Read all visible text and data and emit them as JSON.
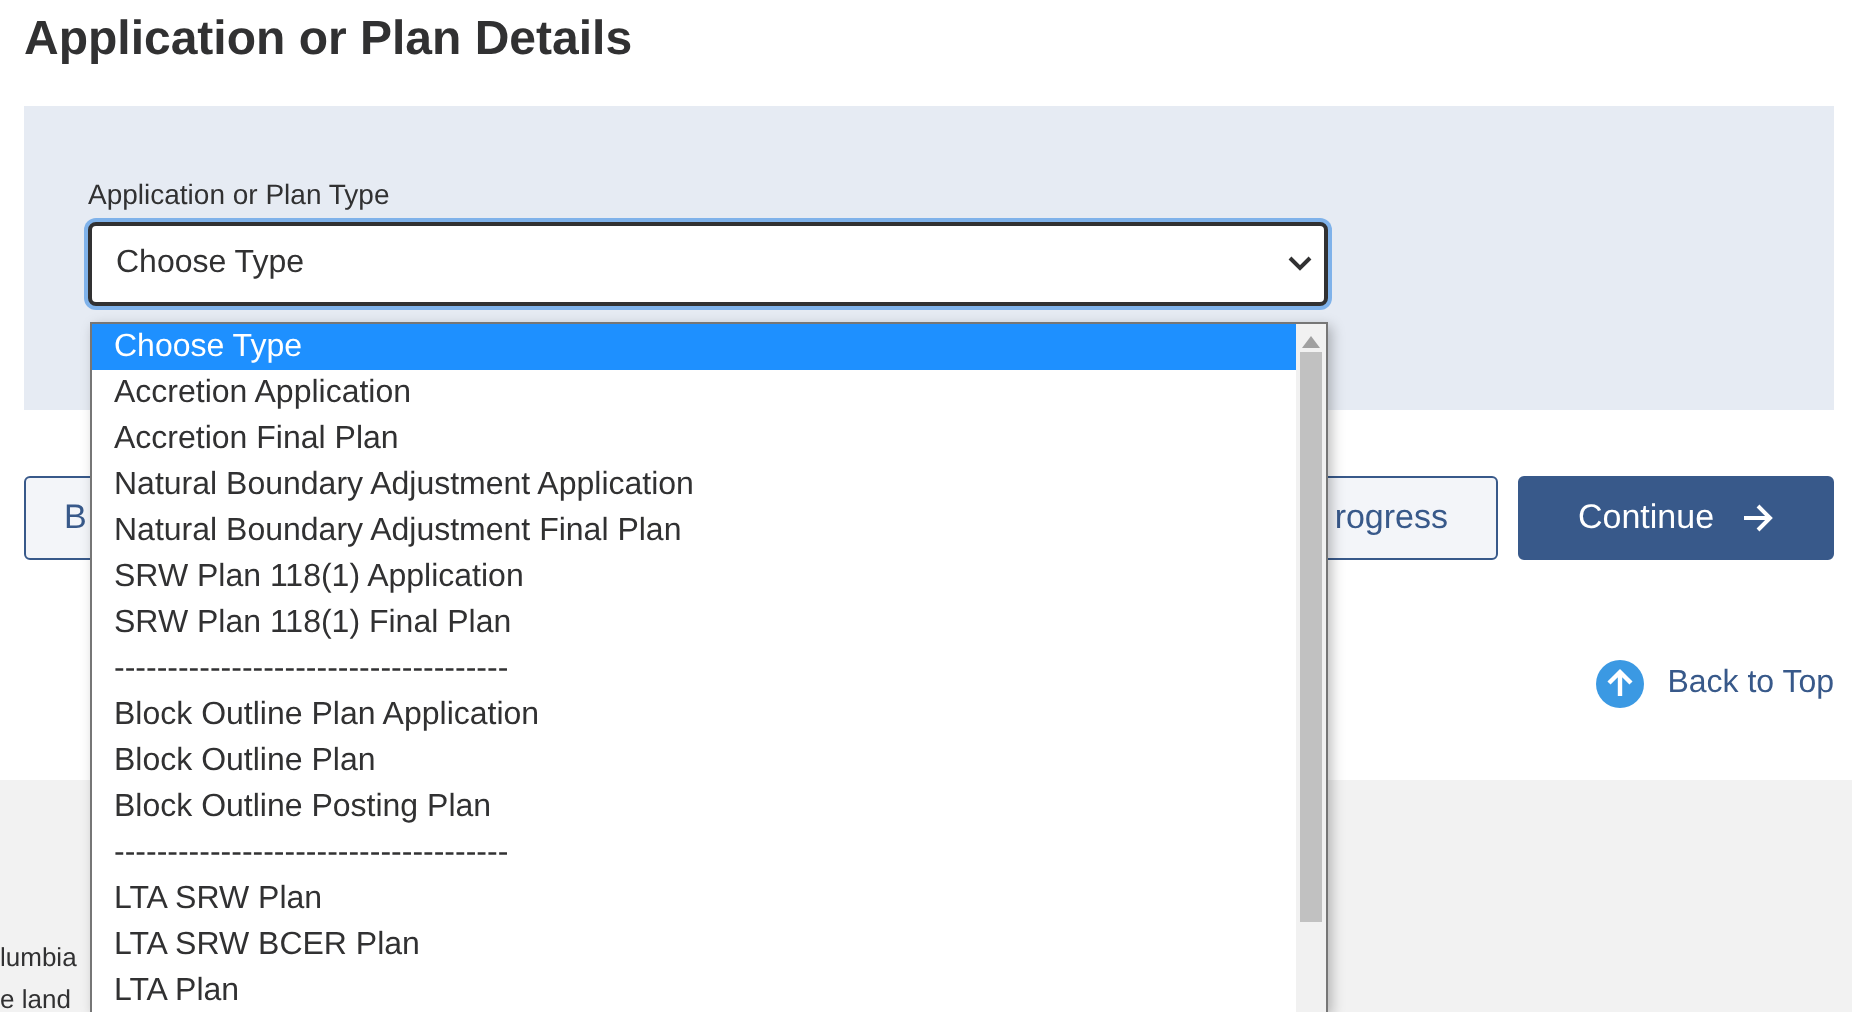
{
  "page_title": "Application or Plan Details",
  "form": {
    "label": "Application or Plan Type",
    "select_value": "Choose Type"
  },
  "dropdown_options": [
    {
      "label": "Choose Type",
      "selected": true
    },
    {
      "label": "Accretion Application",
      "selected": false
    },
    {
      "label": "Accretion Final Plan",
      "selected": false
    },
    {
      "label": "Natural Boundary Adjustment Application",
      "selected": false
    },
    {
      "label": "Natural Boundary Adjustment Final Plan",
      "selected": false
    },
    {
      "label": "SRW Plan 118(1) Application",
      "selected": false
    },
    {
      "label": "SRW Plan 118(1) Final Plan",
      "selected": false
    },
    {
      "label": "-------------------------------------",
      "selected": false
    },
    {
      "label": "Block Outline Plan Application",
      "selected": false
    },
    {
      "label": "Block Outline Plan",
      "selected": false
    },
    {
      "label": "Block Outline Posting Plan",
      "selected": false
    },
    {
      "label": "-------------------------------------",
      "selected": false
    },
    {
      "label": "LTA SRW Plan",
      "selected": false
    },
    {
      "label": "LTA SRW BCER Plan",
      "selected": false
    },
    {
      "label": "LTA Plan",
      "selected": false
    }
  ],
  "buttons": [
    {
      "label": "B",
      "kind": "outline"
    },
    {
      "label": "rogress",
      "kind": "outline"
    },
    {
      "label": "Continue",
      "kind": "primary"
    }
  ],
  "back_to_top": "Back to Top",
  "footer_text": [
    "lumbia",
    "e land"
  ]
}
